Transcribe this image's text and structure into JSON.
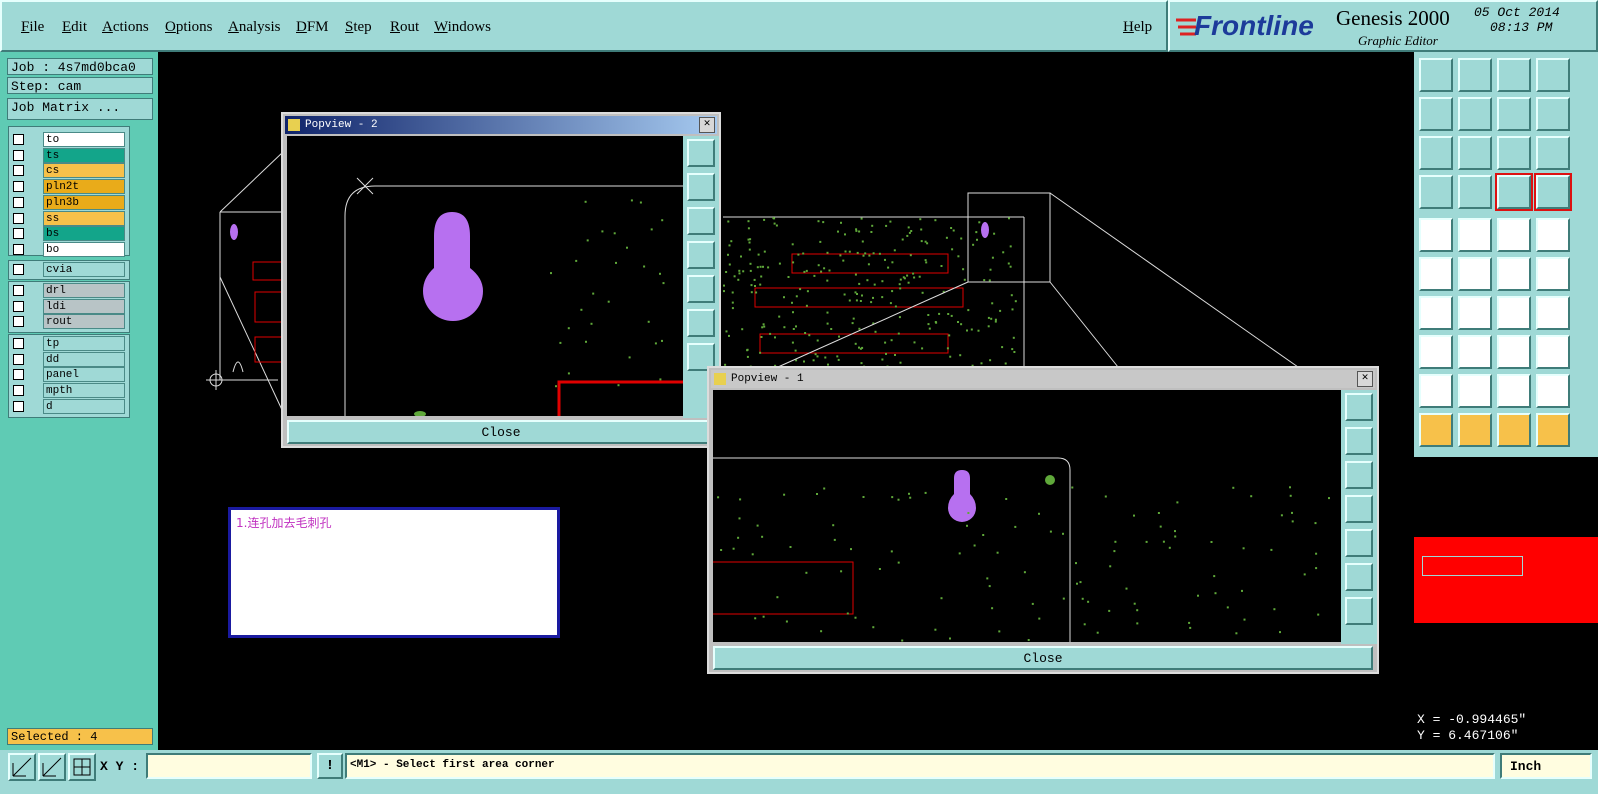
{
  "menubar": {
    "items": [
      "File",
      "Edit",
      "Actions",
      "Options",
      "Analysis",
      "DFM",
      "Step",
      "Rout",
      "Windows"
    ],
    "help": "Help"
  },
  "brand": {
    "logo": "Frontline",
    "product": "Genesis 2000",
    "subtitle": "Graphic Editor",
    "date": "05 Oct 2014",
    "time": "08:13 PM"
  },
  "job": {
    "job_label": "Job : 4s7md0bca0",
    "step_label": "Step: cam",
    "matrix_button": "Job Matrix ..."
  },
  "layers": {
    "group1": [
      {
        "name": "to",
        "color": "#ffffff"
      },
      {
        "name": "ts",
        "color": "#13a58a"
      },
      {
        "name": "cs",
        "color": "#f7c14a"
      },
      {
        "name": "pln2t",
        "color": "#e9ab1a"
      },
      {
        "name": "pln3b",
        "color": "#e9ab1a"
      },
      {
        "name": "ss",
        "color": "#f7c14a"
      },
      {
        "name": "bs",
        "color": "#13a58a"
      },
      {
        "name": "bo",
        "color": "#ffffff"
      }
    ],
    "group2": [
      {
        "name": "cvia",
        "color": "#9fd9d6"
      }
    ],
    "group3": [
      {
        "name": "drl",
        "color": "#b8c4c6"
      },
      {
        "name": "ldi",
        "color": "#b8c4c6"
      },
      {
        "name": "rout",
        "color": "#b8c4c6"
      }
    ],
    "group4": [
      {
        "name": "tp",
        "color": "#9fd9d6"
      },
      {
        "name": "dd",
        "color": "#9fd9d6"
      },
      {
        "name": "panel",
        "color": "#9fd9d6"
      },
      {
        "name": "mpth",
        "color": "#9fd9d6"
      },
      {
        "name": "d",
        "color": "#9fd9d6"
      }
    ]
  },
  "selected": "Selected : 4",
  "popview2": {
    "title": "Popview - 2",
    "close": "Close"
  },
  "popview1": {
    "title": "Popview - 1",
    "close": "Close"
  },
  "note": {
    "text": "1.连孔加去毛刺孔"
  },
  "coords": {
    "x": "X = -0.994465\"",
    "y": "Y = 6.467106\""
  },
  "bottom": {
    "xy_label": "X Y :",
    "xy_value": "",
    "prompt": "<M1> - Select first area corner",
    "units": "Inch"
  },
  "colors": {
    "teal": "#9fd9d6",
    "panel_green": "#5fcbb4",
    "pad_purple": "#b770f0",
    "trace_red": "#e00000",
    "dot_green": "#5fa83a"
  }
}
